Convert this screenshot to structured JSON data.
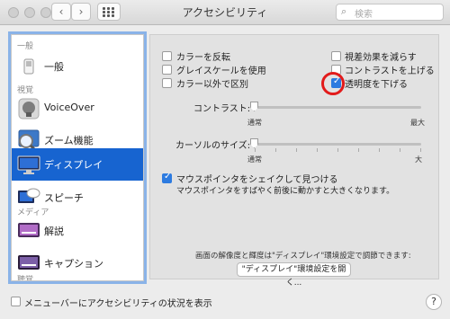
{
  "window": {
    "title": "アクセシビリティ"
  },
  "toolbar": {
    "back_icon": "chevron-left-icon",
    "forward_icon": "chevron-right-icon",
    "back_glyph": "‹",
    "forward_glyph": "›",
    "grid_icon": "grid-icon"
  },
  "search": {
    "placeholder": "検索",
    "icon_glyph": "⌕"
  },
  "sidebar": {
    "categories": [
      "一般",
      "視覚",
      "メディア",
      "聴覚"
    ],
    "items": [
      {
        "label": "一般",
        "icon": "switch-icon"
      },
      {
        "label": "VoiceOver",
        "icon": "voiceover-icon"
      },
      {
        "label": "ズーム機能",
        "icon": "zoom-icon"
      },
      {
        "label": "ディスプレイ",
        "icon": "display-icon",
        "selected": true
      },
      {
        "label": "スピーチ",
        "icon": "speech-icon"
      },
      {
        "label": "解説",
        "icon": "descriptions-icon"
      },
      {
        "label": "キャプション",
        "icon": "captions-icon"
      }
    ]
  },
  "display": {
    "options": [
      {
        "label": "カラーを反転",
        "checked": false
      },
      {
        "label": "グレイスケールを使用",
        "checked": false
      },
      {
        "label": "カラー以外で区別",
        "checked": false
      },
      {
        "label": "視差効果を減らす",
        "checked": false
      },
      {
        "label": "コントラストを上げる",
        "checked": false
      },
      {
        "label": "透明度を下げる",
        "checked": true
      }
    ],
    "contrast": {
      "label": "コントラスト:",
      "min_label": "通常",
      "max_label": "最大"
    },
    "cursor": {
      "label": "カーソルのサイズ:",
      "min_label": "通常",
      "max_label": "大"
    },
    "shake": {
      "label": "マウスポインタをシェイクして見つける",
      "checked": true,
      "description": "マウスポインタをすばやく前後に動かすと大きくなります。"
    },
    "resolution_note": "画面の解像度と輝度は\"ディスプレイ\"環境設定で調節できます:",
    "open_display_button": "\"ディスプレイ\"環境設定を開く..."
  },
  "footer": {
    "menubar_checkbox_label": "メニューバーにアクセシビリティの状況を表示",
    "menubar_checked": false,
    "help_glyph": "?"
  }
}
